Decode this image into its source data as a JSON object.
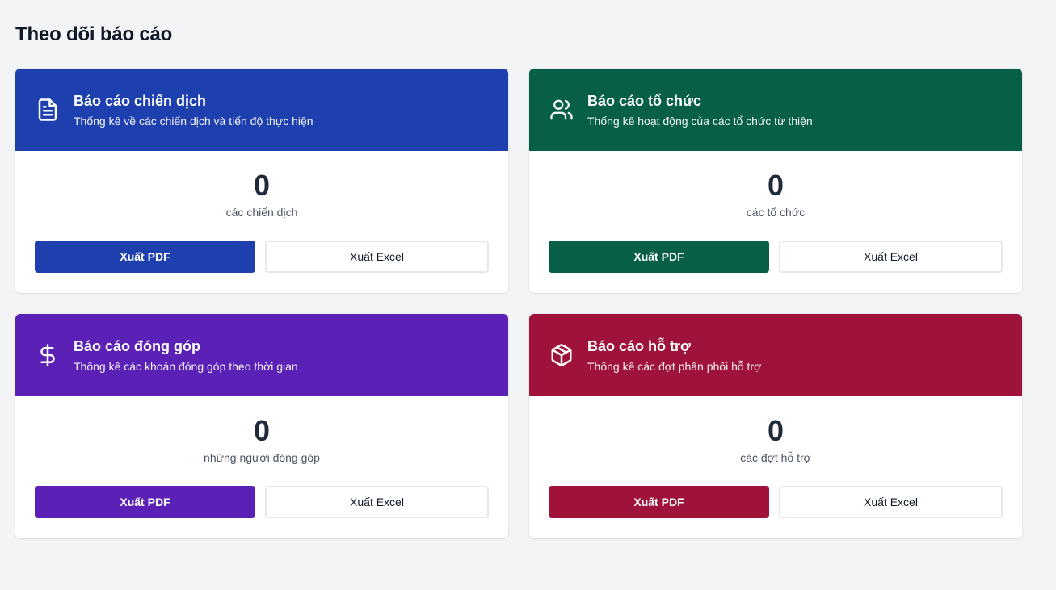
{
  "page": {
    "title": "Theo dõi báo cáo"
  },
  "colors": {
    "campaign": "#1e40af",
    "organization": "#065f46",
    "donation": "#5b21b6",
    "support": "#9f1239"
  },
  "cards": [
    {
      "icon": "document-icon",
      "title": "Báo cáo chiến dịch",
      "subtitle": "Thống kê về các chiến dịch và tiến độ thực hiện",
      "count": "0",
      "count_label": "các chiến dịch",
      "pdf_label": "Xuất PDF",
      "excel_label": "Xuất Excel"
    },
    {
      "icon": "users-icon",
      "title": "Báo cáo tổ chức",
      "subtitle": "Thống kê hoạt động của các tổ chức từ thiện",
      "count": "0",
      "count_label": "các tổ chức",
      "pdf_label": "Xuất PDF",
      "excel_label": "Xuất Excel"
    },
    {
      "icon": "dollar-icon",
      "title": "Báo cáo đóng góp",
      "subtitle": "Thống kê các khoản đóng góp theo thời gian",
      "count": "0",
      "count_label": "những người đóng góp",
      "pdf_label": "Xuất PDF",
      "excel_label": "Xuất Excel"
    },
    {
      "icon": "package-icon",
      "title": "Báo cáo hỗ trợ",
      "subtitle": "Thống kê các đợt phân phối hỗ trợ",
      "count": "0",
      "count_label": "các đợt hỗ trợ",
      "pdf_label": "Xuất PDF",
      "excel_label": "Xuất Excel"
    }
  ]
}
